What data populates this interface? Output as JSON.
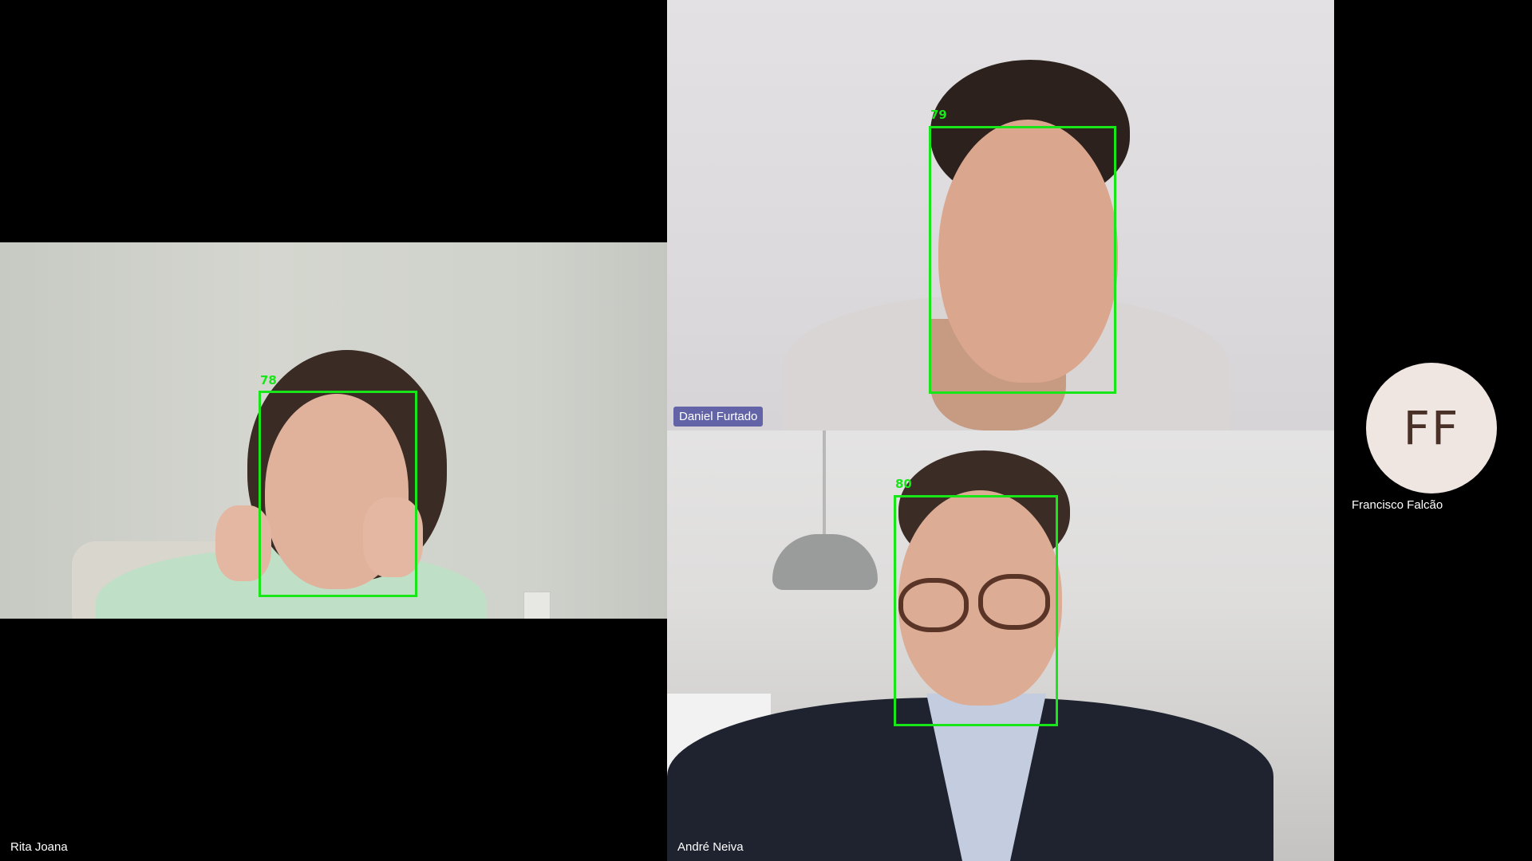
{
  "window": {
    "background": "#000000"
  },
  "participants": [
    {
      "name": "Rita Joana",
      "face_score": "78",
      "label_style": "plain"
    },
    {
      "name": "Daniel Furtado",
      "face_score": "79",
      "label_style": "pill"
    },
    {
      "name": "André Neiva",
      "face_score": "80",
      "label_style": "plain"
    },
    {
      "name": "Francisco Falcão",
      "initials": "FF",
      "video": "off"
    }
  ],
  "colors": {
    "face_box": "#19e619",
    "name_pill": "#6264a7",
    "avatar_bg": "#efe6e2",
    "avatar_text": "#4a3128"
  }
}
